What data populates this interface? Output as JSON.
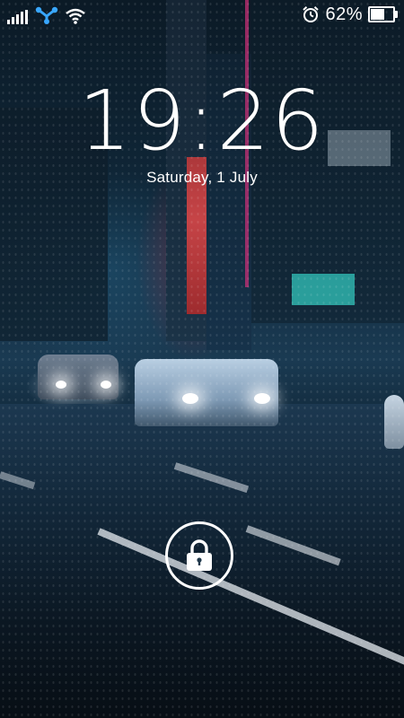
{
  "status_bar": {
    "battery_percent_text": "62%",
    "battery_level": 0.62,
    "icons": [
      "signal-bars-icon",
      "network-share-icon",
      "wifi-icon",
      "alarm-clock-icon",
      "battery-icon"
    ]
  },
  "lock_screen": {
    "time": "19:26",
    "date": "Saturday, 1 July",
    "unlock_icon": "padlock-icon"
  },
  "colors": {
    "text": "#ffffff",
    "share_icon": "#39a7ff"
  }
}
